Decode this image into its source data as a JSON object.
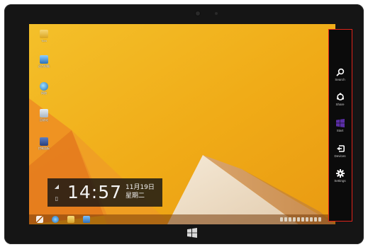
{
  "clock": {
    "time": "14:57",
    "date_line1": "11月19日",
    "date_line2": "星期二"
  },
  "desktop_icons": [
    {
      "label": "Tom",
      "icon": "user-folder-icon"
    },
    {
      "label": "这台电脑",
      "icon": "computer-icon"
    },
    {
      "label": "网络",
      "icon": "network-icon"
    },
    {
      "label": "回收站",
      "icon": "recycle-bin-icon"
    },
    {
      "label": "控制面板",
      "icon": "control-panel-icon"
    }
  ],
  "charms": [
    {
      "label": "Search",
      "icon": "search-icon"
    },
    {
      "label": "Share",
      "icon": "share-icon"
    },
    {
      "label": "Start",
      "icon": "windows-logo-icon"
    },
    {
      "label": "Devices",
      "icon": "devices-icon"
    },
    {
      "label": "Settings",
      "icon": "gear-icon"
    }
  ],
  "colors": {
    "wallpaper_orange": "#f2b21a",
    "charms_border": "#e0241b",
    "start_charm": "#5b2ea6"
  }
}
